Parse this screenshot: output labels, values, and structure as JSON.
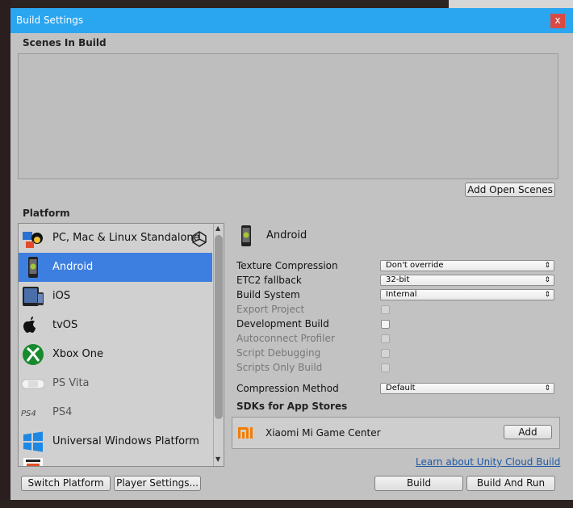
{
  "window": {
    "title": "Build Settings",
    "close_label": "x"
  },
  "scenes": {
    "label": "Scenes In Build",
    "add_open_scenes": "Add Open Scenes"
  },
  "platform": {
    "label": "Platform",
    "items": [
      {
        "label": "PC, Mac & Linux Standalone",
        "icon": "pc-mac-linux-icon",
        "selected": false,
        "dim": false
      },
      {
        "label": "Android",
        "icon": "android-icon",
        "selected": true,
        "dim": false
      },
      {
        "label": "iOS",
        "icon": "ios-icon",
        "selected": false,
        "dim": false
      },
      {
        "label": "tvOS",
        "icon": "tvos-icon",
        "selected": false,
        "dim": false
      },
      {
        "label": "Xbox One",
        "icon": "xbox-icon",
        "selected": false,
        "dim": false
      },
      {
        "label": "PS Vita",
        "icon": "ps-vita-icon",
        "selected": false,
        "dim": true
      },
      {
        "label": "PS4",
        "icon": "ps4-icon",
        "selected": false,
        "dim": true
      },
      {
        "label": "Universal Windows Platform",
        "icon": "windows-icon",
        "selected": false,
        "dim": false
      }
    ]
  },
  "settings": {
    "platform_name": "Android",
    "rows": [
      {
        "label": "Texture Compression",
        "type": "dropdown",
        "value": "Don't override",
        "dim": false
      },
      {
        "label": "ETC2 fallback",
        "type": "dropdown",
        "value": "32-bit",
        "dim": false
      },
      {
        "label": "Build System",
        "type": "dropdown",
        "value": "Internal",
        "dim": false
      },
      {
        "label": "Export Project",
        "type": "checkbox",
        "checked": false,
        "dim": true
      },
      {
        "label": "Development Build",
        "type": "checkbox",
        "checked": false,
        "dim": false
      },
      {
        "label": "Autoconnect Profiler",
        "type": "checkbox",
        "checked": false,
        "dim": true
      },
      {
        "label": "Script Debugging",
        "type": "checkbox",
        "checked": false,
        "dim": true
      },
      {
        "label": "Scripts Only Build",
        "type": "checkbox",
        "checked": false,
        "dim": true
      },
      {
        "label": "Compression Method",
        "type": "dropdown",
        "value": "Default",
        "dim": false
      }
    ],
    "sdks_label": "SDKs for App Stores",
    "sdk": {
      "name": "Xiaomi Mi Game Center",
      "icon": "xiaomi-icon",
      "add_label": "Add"
    },
    "cloud_link": "Learn about Unity Cloud Build"
  },
  "footer": {
    "switch_platform": "Switch Platform",
    "player_settings": "Player Settings...",
    "build": "Build",
    "build_and_run": "Build And Run"
  },
  "colors": {
    "titlebar": "#2aa5f0",
    "selection": "#3d7fe0",
    "close": "#d94a44"
  }
}
